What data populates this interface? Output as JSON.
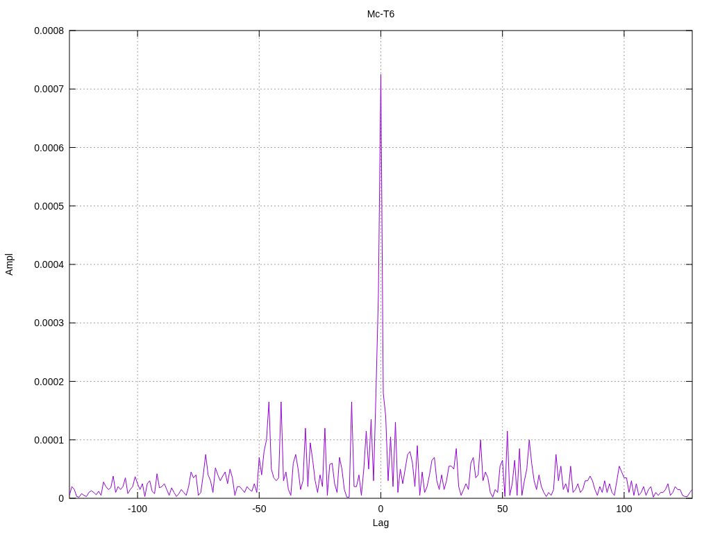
{
  "chart_data": {
    "type": "line",
    "grid": true,
    "title": "Mc-T6",
    "xlabel": "Lag",
    "ylabel": "Ampl",
    "xlim": [
      -128,
      128
    ],
    "ylim": [
      0,
      0.0008
    ],
    "xticks": [
      -100,
      -50,
      0,
      50,
      100
    ],
    "yticks": [
      0,
      0.0001,
      0.0002,
      0.0003,
      0.0004,
      0.0005,
      0.0006,
      0.0007,
      0.0008
    ],
    "x": [
      -128,
      -127,
      -126,
      -125,
      -124,
      -123,
      -122,
      -121,
      -120,
      -119,
      -118,
      -117,
      -116,
      -115,
      -114,
      -113,
      -112,
      -111,
      -110,
      -109,
      -108,
      -107,
      -106,
      -105,
      -104,
      -103,
      -102,
      -101,
      -100,
      -99,
      -98,
      -97,
      -96,
      -95,
      -94,
      -93,
      -92,
      -91,
      -90,
      -89,
      -88,
      -87,
      -86,
      -85,
      -84,
      -83,
      -82,
      -81,
      -80,
      -79,
      -78,
      -77,
      -76,
      -75,
      -74,
      -73,
      -72,
      -71,
      -70,
      -69,
      -68,
      -67,
      -66,
      -65,
      -64,
      -63,
      -62,
      -61,
      -60,
      -59,
      -58,
      -57,
      -56,
      -55,
      -54,
      -53,
      -52,
      -51,
      -50,
      -49,
      -48,
      -47,
      -46,
      -45,
      -44,
      -43,
      -42,
      -41,
      -40,
      -39,
      -38,
      -37,
      -36,
      -35,
      -34,
      -33,
      -32,
      -31,
      -30,
      -29,
      -28,
      -27,
      -26,
      -25,
      -24,
      -23,
      -22,
      -21,
      -20,
      -19,
      -18,
      -17,
      -16,
      -15,
      -14,
      -13,
      -12,
      -11,
      -10,
      -9,
      -8,
      -7,
      -6,
      -5,
      -4,
      -3,
      -2,
      -1,
      0,
      1,
      2,
      3,
      4,
      5,
      6,
      7,
      8,
      9,
      10,
      11,
      12,
      13,
      14,
      15,
      16,
      17,
      18,
      19,
      20,
      21,
      22,
      23,
      24,
      25,
      26,
      27,
      28,
      29,
      30,
      31,
      32,
      33,
      34,
      35,
      36,
      37,
      38,
      39,
      40,
      41,
      42,
      43,
      44,
      45,
      46,
      47,
      48,
      49,
      50,
      51,
      52,
      53,
      54,
      55,
      56,
      57,
      58,
      59,
      60,
      61,
      62,
      63,
      64,
      65,
      66,
      67,
      68,
      69,
      70,
      71,
      72,
      73,
      74,
      75,
      76,
      77,
      78,
      79,
      80,
      81,
      82,
      83,
      84,
      85,
      86,
      87,
      88,
      89,
      90,
      91,
      92,
      93,
      94,
      95,
      96,
      97,
      98,
      99,
      100,
      101,
      102,
      103,
      104,
      105,
      106,
      107,
      108,
      109,
      110,
      111,
      112,
      113,
      114,
      115,
      116,
      117,
      118,
      119,
      120,
      121,
      122,
      123,
      124,
      125,
      126,
      127,
      128
    ],
    "series": [
      {
        "color": "#9400d3",
        "values": [
          5e-06,
          2e-05,
          1.5e-05,
          3e-06,
          2e-06,
          8e-06,
          5e-06,
          3e-06,
          1e-05,
          1.3e-05,
          1e-05,
          6e-06,
          1.2e-05,
          5e-06,
          2.8e-05,
          2e-05,
          1.5e-05,
          1.8e-05,
          3.8e-05,
          1e-05,
          2e-05,
          1.5e-05,
          2e-05,
          3.5e-05,
          8e-06,
          1.5e-05,
          2e-05,
          3.7e-05,
          2.5e-05,
          1.5e-05,
          2.5e-05,
          3e-06,
          2.5e-05,
          3e-05,
          1.2e-05,
          8e-06,
          4.2e-05,
          1.8e-05,
          2e-05,
          2.5e-05,
          1.5e-05,
          5e-06,
          1.8e-05,
          1e-05,
          3e-06,
          8e-06,
          1.5e-05,
          1e-05,
          5e-06,
          2e-05,
          4.5e-05,
          3.5e-05,
          4e-05,
          5e-06,
          1e-05,
          4e-05,
          7.5e-05,
          4e-05,
          3e-05,
          1e-05,
          5.2e-05,
          4e-05,
          3e-05,
          3.8e-05,
          4.5e-05,
          2.5e-05,
          5e-05,
          3.5e-05,
          5e-06,
          2e-05,
          2e-05,
          1.5e-05,
          1e-05,
          2e-05,
          1.5e-05,
          1.2e-05,
          2.5e-05,
          1e-05,
          7e-05,
          4e-05,
          8e-05,
          0.0001,
          0.000165,
          5e-05,
          3.5e-05,
          3e-05,
          3.5e-05,
          0.000165,
          3e-05,
          4.5e-05,
          1.5e-05,
          5e-06,
          6e-05,
          7.5e-05,
          5e-05,
          1.5e-05,
          3e-05,
          0.00012,
          2e-05,
          9.5e-05,
          6.5e-05,
          3e-05,
          1e-05,
          4e-05,
          2e-05,
          0.00012,
          5e-06,
          5.8e-05,
          6e-05,
          2.5e-05,
          1e-05,
          7e-05,
          5e-05,
          1.5e-05,
          2e-06,
          2e-06,
          0.000165,
          2e-05,
          2e-05,
          4e-05,
          5e-06,
          5e-05,
          0.000115,
          5e-05,
          0.000135,
          3e-05,
          0.00018,
          0.00035,
          0.000725,
          0.00018,
          0.00014,
          3e-05,
          0.000105,
          2e-05,
          0.00013,
          1e-05,
          5e-05,
          2.5e-05,
          5e-05,
          7.5e-05,
          8e-05,
          6e-05,
          2e-05,
          9e-05,
          5e-06,
          4.5e-05,
          1e-05,
          2e-05,
          4e-05,
          6.5e-05,
          7e-05,
          3e-05,
          1.5e-05,
          4e-05,
          1.5e-05,
          3e-05,
          5.5e-05,
          5.5e-05,
          5e-05,
          8.5e-05,
          2e-05,
          5e-06,
          1.5e-05,
          2.5e-05,
          1.5e-05,
          6e-05,
          7e-05,
          3.5e-05,
          4e-05,
          0.0001,
          3e-05,
          4.5e-05,
          3.5e-05,
          1e-05,
          2e-06,
          1.5e-05,
          1e-05,
          5.5e-05,
          6.5e-05,
          3e-06,
          0.000115,
          5e-06,
          2.5e-05,
          6.5e-05,
          5e-06,
          8.5e-05,
          5e-06,
          3e-05,
          5e-05,
          0.0001,
          6e-05,
          3e-05,
          1.5e-05,
          4e-05,
          2e-05,
          1e-05,
          3e-06,
          1e-05,
          5e-06,
          1.5e-05,
          7.5e-05,
          3e-05,
          5.5e-05,
          1.5e-05,
          2.5e-05,
          1e-05,
          5.5e-05,
          1e-05,
          1.5e-05,
          2.5e-05,
          1e-05,
          1.5e-05,
          3e-05,
          3e-05,
          3.8e-05,
          3e-05,
          1.5e-05,
          5e-06,
          2e-05,
          1e-05,
          3e-05,
          1e-05,
          2.5e-05,
          1e-05,
          5e-06,
          3e-05,
          5.5e-05,
          4.5e-05,
          3.5e-05,
          3.5e-05,
          1e-05,
          3e-05,
          5e-06,
          2.5e-05,
          5e-06,
          1e-05,
          2e-05,
          5e-06,
          1.5e-05,
          2e-05,
          2e-06,
          1e-05,
          5e-06,
          1e-05,
          1e-05,
          1.5e-05,
          2.5e-05,
          5e-06,
          1e-05,
          2e-05,
          1.5e-05,
          1.5e-05,
          5e-06,
          3e-06,
          3e-06,
          1e-05,
          1.5e-05
        ]
      }
    ]
  }
}
